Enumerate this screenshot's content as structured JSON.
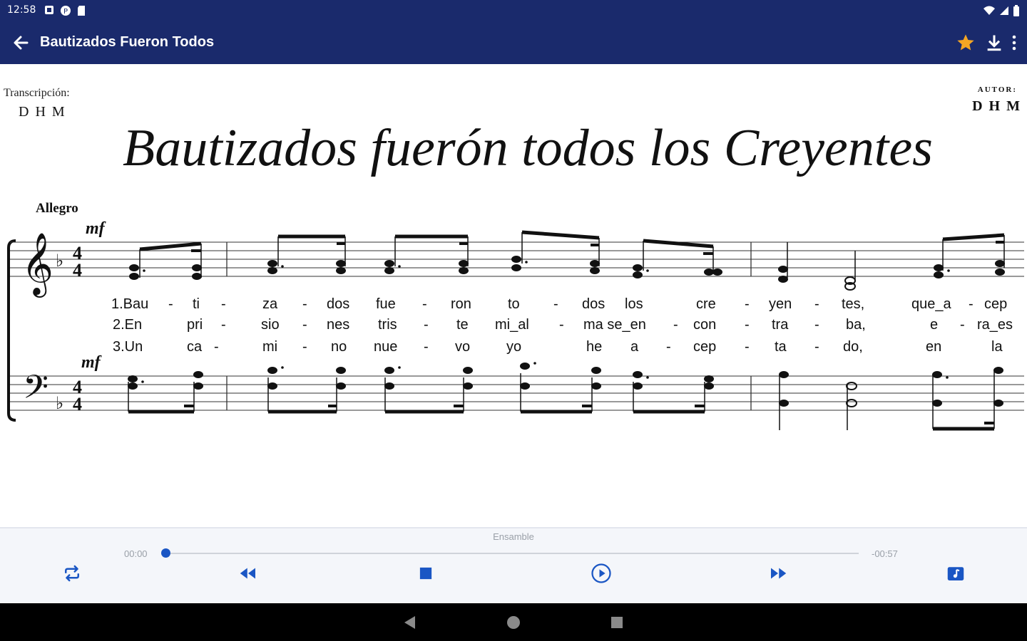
{
  "status_bar": {
    "time": "12:58"
  },
  "app_bar": {
    "title": "Bautizados Fueron Todos"
  },
  "score": {
    "transcription_label": "Transcripción:",
    "transcription_name": "D H M",
    "author_label": "AUTOR:",
    "author_name": "D H M",
    "title": "Bautizados fuerón todos los Creyentes",
    "tempo": "Allegro",
    "dynamic_top": "mf",
    "dynamic_bottom": "mf",
    "lyrics": {
      "verse1": [
        "1.Bau",
        "-",
        "ti",
        "-",
        "za",
        "-",
        "dos",
        "fue",
        "-",
        "ron",
        "to",
        "-",
        "dos",
        "los",
        "cre",
        "-",
        "yen",
        "-",
        "tes,",
        "que_a",
        "-",
        "cep"
      ],
      "verse2": [
        "2.En",
        "pri",
        "-",
        "sio",
        "-",
        "nes",
        "tris",
        "-",
        "te",
        "mi_al",
        "-",
        "ma se_en",
        "-",
        "con",
        "-",
        "tra",
        "-",
        "ba,",
        "e",
        "-",
        "ra_es"
      ],
      "verse3": [
        "3.Un",
        "ca",
        "-",
        "mi",
        "-",
        "no",
        "nue",
        "-",
        "vo",
        "yo",
        "he",
        "a",
        "-",
        "cep",
        "-",
        "ta",
        "-",
        "do,",
        "en",
        "la"
      ]
    }
  },
  "player": {
    "ensemble_label": "Ensamble",
    "time_elapsed": "00:00",
    "time_remaining": "-00:57",
    "progress": 0.0
  },
  "colors": {
    "app_bar": "#1a2a6c",
    "accent": "#1a56c4",
    "star": "#f5a623"
  },
  "icons": {
    "back": "arrow-left-icon",
    "favorite": "star-icon",
    "download": "download-icon",
    "more": "more-vert-icon",
    "repeat": "repeat-icon",
    "rewind": "fast-rewind-icon",
    "stop": "stop-icon",
    "play": "play-circle-icon",
    "forward": "fast-forward-icon",
    "music": "music-note-icon"
  }
}
